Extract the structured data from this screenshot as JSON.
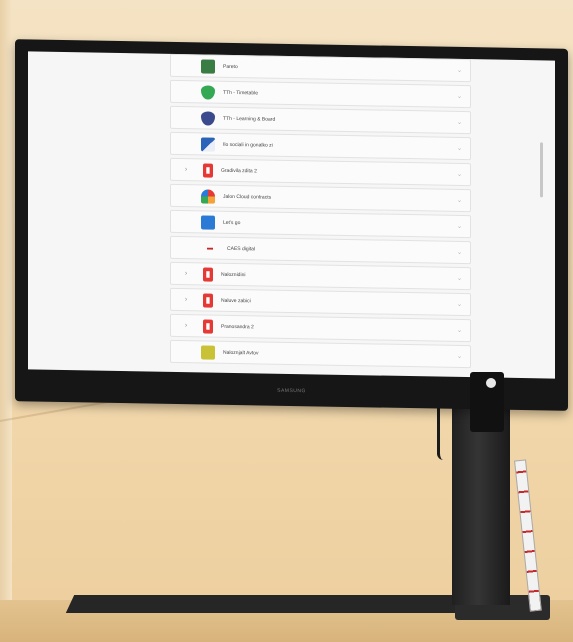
{
  "screen": {
    "brand": "SAMSUNG",
    "rows": [
      {
        "label": "Pareto",
        "icon": "square-green-icon",
        "color": "#3a7d44",
        "glyph": "",
        "expander": ""
      },
      {
        "label": "TTh - Timetable",
        "icon": "shield-green-icon",
        "color": "#34a853",
        "glyph": "",
        "expander": ""
      },
      {
        "label": "TTh - Learning & Board",
        "icon": "shield-blue-icon",
        "color": "#3b4a8c",
        "glyph": "",
        "expander": ""
      },
      {
        "label": "Ilo sociali in gonalko zi",
        "icon": "road-icon",
        "color": "#2a63b8",
        "glyph": "",
        "expander": ""
      },
      {
        "label": "Gradivila zdita 2",
        "icon": "red-doc-icon",
        "color": "#e53935",
        "glyph": "",
        "expander": "›"
      },
      {
        "label": "Jalon Cloud contracts",
        "icon": "colorful-logo-icon",
        "color": "#f2a33a",
        "glyph": "",
        "expander": ""
      },
      {
        "label": "Let's go",
        "icon": "blue-map-icon",
        "color": "#2b7bd6",
        "glyph": "",
        "expander": ""
      },
      {
        "label": "CAES digital",
        "icon": "wordmark-logo-icon",
        "color": "#c62828",
        "glyph": "",
        "expander": ""
      },
      {
        "label": "Naloznidini",
        "icon": "red-doc-icon",
        "color": "#e53935",
        "glyph": "",
        "expander": "›"
      },
      {
        "label": "Naluve zabici",
        "icon": "red-doc-icon",
        "color": "#e53935",
        "glyph": "",
        "expander": "›"
      },
      {
        "label": "Pranosandra 2",
        "icon": "red-doc-icon",
        "color": "#e53935",
        "glyph": "",
        "expander": "›"
      },
      {
        "label": "Naloznjalt Avtov",
        "icon": "yellow-tile-icon",
        "color": "#c9c236",
        "glyph": "",
        "expander": ""
      }
    ]
  }
}
